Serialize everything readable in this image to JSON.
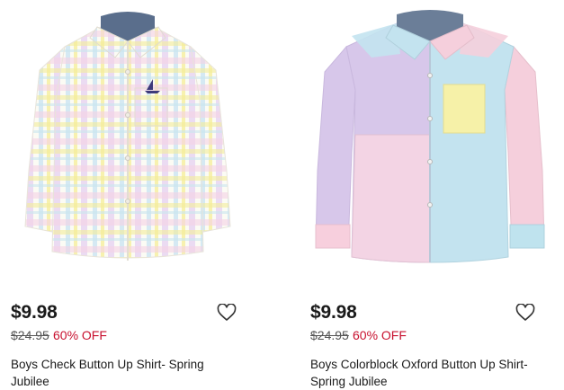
{
  "products": [
    {
      "name": "Boys Check Button Up Shirt- Spring Jubilee",
      "price": "$9.98",
      "original_price": "$24.95",
      "discount": "60% OFF",
      "image_icon": "plaid-shirt-image",
      "favorite_icon": "heart-outline-icon"
    },
    {
      "name": "Boys Colorblock Oxford Button Up Shirt- Spring Jubilee",
      "price": "$9.98",
      "original_price": "$24.95",
      "discount": "60% OFF",
      "image_icon": "colorblock-shirt-image",
      "favorite_icon": "heart-outline-icon"
    }
  ],
  "colors": {
    "discount": "#c8102e",
    "strikethrough": "#555555",
    "heart": "#333333"
  }
}
